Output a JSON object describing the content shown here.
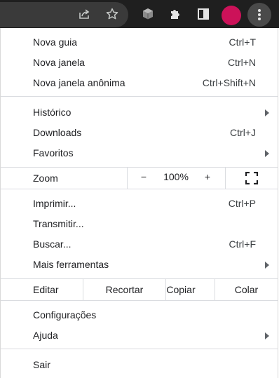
{
  "toolbar": {
    "icons": [
      "share-icon",
      "star-icon",
      "extension-box-icon",
      "puzzle-icon",
      "side-panel-icon",
      "avatar",
      "kebab-menu-icon"
    ],
    "avatar_color": "#cc1259"
  },
  "menu": {
    "new_tab": {
      "label": "Nova guia",
      "accel": "Ctrl+T"
    },
    "new_window": {
      "label": "Nova janela",
      "accel": "Ctrl+N"
    },
    "incognito": {
      "label": "Nova janela anônima",
      "accel": "Ctrl+Shift+N"
    },
    "history": {
      "label": "Histórico"
    },
    "downloads": {
      "label": "Downloads",
      "accel": "Ctrl+J"
    },
    "bookmarks": {
      "label": "Favoritos"
    },
    "zoom": {
      "label": "Zoom",
      "minus": "−",
      "value": "100%",
      "plus": "+"
    },
    "print": {
      "label": "Imprimir...",
      "accel": "Ctrl+P"
    },
    "cast": {
      "label": "Transmitir..."
    },
    "find": {
      "label": "Buscar...",
      "accel": "Ctrl+F"
    },
    "more_tools": {
      "label": "Mais ferramentas"
    },
    "edit": {
      "label": "Editar",
      "cut": "Recortar",
      "copy": "Copiar",
      "paste": "Colar"
    },
    "settings": {
      "label": "Configurações"
    },
    "help": {
      "label": "Ajuda"
    },
    "exit": {
      "label": "Sair"
    }
  }
}
